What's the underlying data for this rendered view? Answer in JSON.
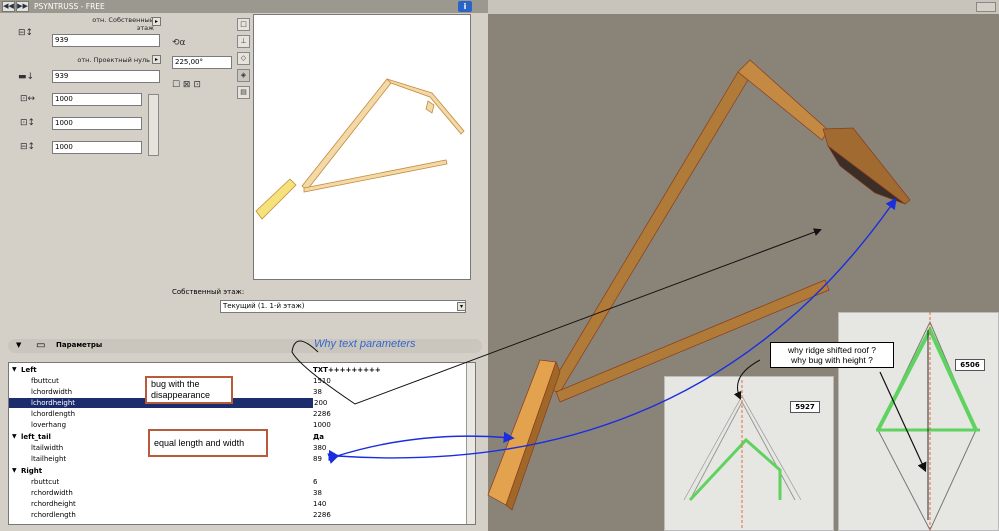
{
  "title_bar": {
    "prev_label": "◀◀",
    "next_label": "▶▶",
    "title": "PSYNTRUSS - FREE",
    "info_label": "i"
  },
  "fields": {
    "label_own_floor": "отн. Собственный этаж",
    "elevation_own": "939",
    "label_project_zero": "отн. Проектный нуль",
    "elevation_project": "939",
    "angle": "225,00°",
    "field_a": "1000",
    "field_b": "1000",
    "field_c": "1000"
  },
  "floor": {
    "label": "Собственный этаж:",
    "value": "Текущий (1. 1-й этаж)"
  },
  "params_header": "Параметры",
  "params": [
    {
      "name": "Left",
      "value": "TXT+++++++++",
      "group": true
    },
    {
      "name": "fbuttcut",
      "value": "1510"
    },
    {
      "name": "lchordwidth",
      "value": "38"
    },
    {
      "name": "lchordheight",
      "value": "200",
      "selected": true
    },
    {
      "name": "lchordlength",
      "value": "2286"
    },
    {
      "name": "loverhang",
      "value": "1000"
    },
    {
      "name": "left_tail",
      "value": "Да",
      "group": true
    },
    {
      "name": "ltailwidth",
      "value": "380"
    },
    {
      "name": "ltailheight",
      "value": "89"
    },
    {
      "name": "Right",
      "value": "",
      "group": true
    },
    {
      "name": "rbuttcut",
      "value": "6"
    },
    {
      "name": "rchordwidth",
      "value": "38"
    },
    {
      "name": "rchordheight",
      "value": "140"
    },
    {
      "name": "rchordlength",
      "value": "2286"
    }
  ],
  "annotations": {
    "text_params": "Why text parameters",
    "bug_disappear": "bug with the disappearance",
    "equal": "equal length and width",
    "ridge_line1": "why ridge shifted roof ?",
    "ridge_line2": "why bug with height ?"
  },
  "dims": {
    "left": "5927",
    "right": "6506"
  },
  "colors": {
    "wood": "#c8903e",
    "green": "#5fd35f",
    "arrow_blue": "#1a2ee0",
    "callout_border": "#b85b3a",
    "selected_row": "#1c2d6e"
  }
}
